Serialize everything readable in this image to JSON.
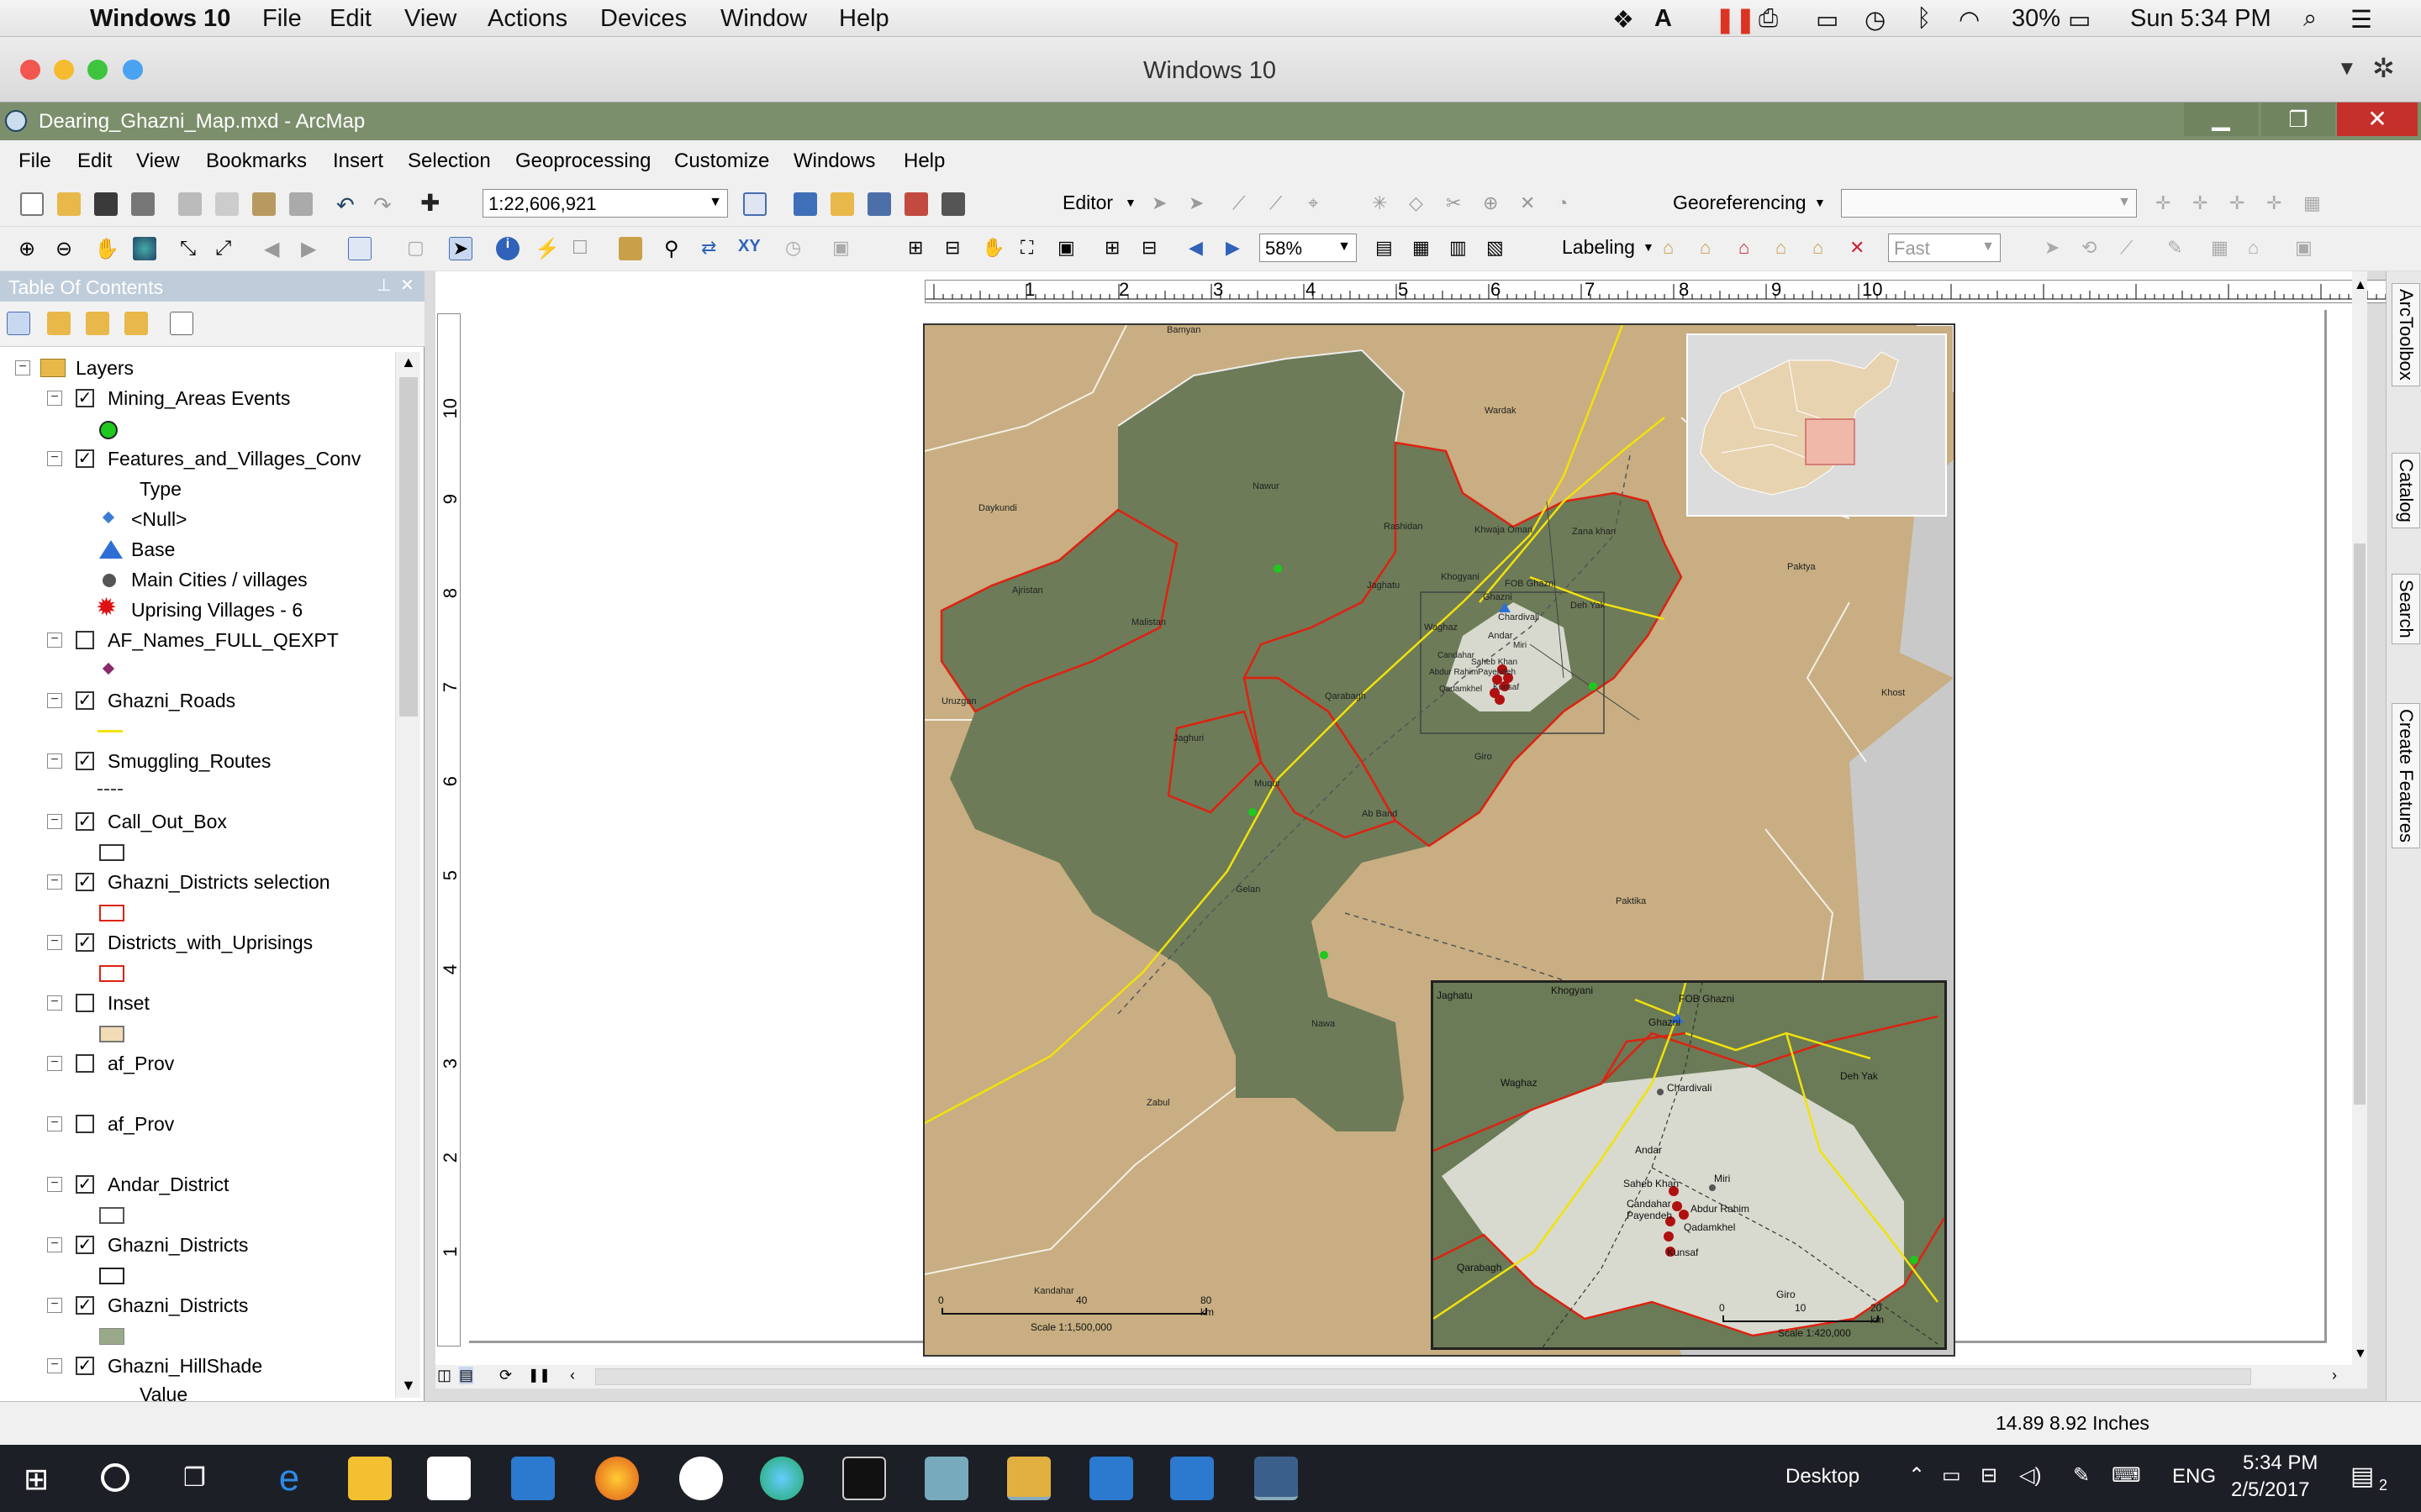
{
  "mac_menubar": {
    "app_name": "Windows 10",
    "menus": [
      "File",
      "Edit",
      "View",
      "Actions",
      "Devices",
      "Window",
      "Help"
    ],
    "battery": "30%",
    "clock": "Sun 5:34 PM"
  },
  "vm_window": {
    "title": "Windows 10"
  },
  "arc_window": {
    "title": "Dearing_Ghazni_Map.mxd - ArcMap"
  },
  "arc_menus": [
    "File",
    "Edit",
    "View",
    "Bookmarks",
    "Insert",
    "Selection",
    "Geoprocessing",
    "Customize",
    "Windows",
    "Help"
  ],
  "toolbar1": {
    "scale": "1:22,606,921",
    "editor_label": "Editor",
    "georef_label": "Georeferencing",
    "georef_value": ""
  },
  "toolbar2": {
    "zoom": "58%",
    "labeling_label": "Labeling",
    "quality": "Fast"
  },
  "toc": {
    "title": "Table Of Contents",
    "root": "Layers",
    "layers": [
      {
        "name": "Mining_Areas Events",
        "checked": true,
        "symbol": "green-circle"
      },
      {
        "name": "Features_and_Villages_Conv",
        "checked": true,
        "sub_header": "Type",
        "items": [
          {
            "label": "<Null>",
            "symbol": "blue-diamond"
          },
          {
            "label": "Base",
            "symbol": "blue-triangle"
          },
          {
            "label": "Main Cities / villages",
            "symbol": "gray-dot"
          },
          {
            "label": "Uprising Villages - 6",
            "symbol": "red-burst"
          }
        ]
      },
      {
        "name": "AF_Names_FULL_QEXPT",
        "checked": false,
        "symbol": "purple-diamond"
      },
      {
        "name": "Ghazni_Roads",
        "checked": true,
        "symbol": "yellow-line"
      },
      {
        "name": "Smuggling_Routes",
        "checked": true,
        "symbol": "dashed-line"
      },
      {
        "name": "Call_Out_Box",
        "checked": true,
        "symbol": "white-box"
      },
      {
        "name": "Ghazni_Districts selection",
        "checked": true,
        "symbol": "red-box"
      },
      {
        "name": "Districts_with_Uprisings",
        "checked": true,
        "symbol": "red-box"
      },
      {
        "name": "Inset",
        "checked": false,
        "symbol": "tan-box"
      },
      {
        "name": "af_Prov",
        "checked": false,
        "symbol": ""
      },
      {
        "name": "af_Prov",
        "checked": false,
        "symbol": ""
      },
      {
        "name": "Andar_District",
        "checked": true,
        "symbol": "white-box"
      },
      {
        "name": "Ghazni_Districts",
        "checked": true,
        "symbol": "white-box"
      },
      {
        "name": "Ghazni_Districts",
        "checked": true,
        "symbol": "green-box"
      },
      {
        "name": "Ghazni_HillShade",
        "checked": true,
        "sub_header": "Value"
      }
    ]
  },
  "ruler": {
    "h_ticks": [
      "1",
      "2",
      "3",
      "4",
      "5",
      "6",
      "7",
      "8",
      "9",
      "10"
    ],
    "v_ticks": [
      "10",
      "9",
      "8",
      "7",
      "6",
      "5",
      "4",
      "3",
      "2",
      "1"
    ]
  },
  "map_labels": {
    "main": [
      "Bamyan",
      "Daykundi",
      "Nawur",
      "Wardak",
      "Rashidan",
      "Khwaja Omari",
      "Zana khan",
      "Ajristan",
      "Malistan",
      "Jaghatu",
      "Khogyani",
      "FOB Ghazni",
      "Ghazni",
      "Chardivali",
      "Deh Yak",
      "Waghaz",
      "Andar",
      "Giro",
      "Qarabagh",
      "Jaghuri",
      "Muqur",
      "Ab Band",
      "Gelan",
      "Nawa",
      "Paktika",
      "Paktya",
      "Khost",
      "Uruzgan",
      "Zabul",
      "Kandahar",
      "Saheb Khan",
      "Abdur Rahim",
      "Payendeh",
      "Qadamkhel",
      "Kunsaf",
      "Candahar",
      "Miri"
    ],
    "main_scale_ticks": [
      "0",
      "40",
      "80 km"
    ],
    "main_scale_text": "Scale 1:1,500,000",
    "inset": [
      "Jaghatu",
      "Khogyani",
      "FOB Ghazni",
      "Ghazni",
      "Waghaz",
      "Chardivali",
      "Deh Yak",
      "Andar",
      "Miri",
      "Saheb Khan",
      "Candahar",
      "Payendeh",
      "Abdur Rahim",
      "Qadamkhel",
      "Kunsaf",
      "Qarabagh",
      "Giro"
    ],
    "inset_scale_ticks": [
      "0",
      "10",
      "20 km"
    ],
    "inset_scale_text": "Scale 1:420,000"
  },
  "statusbar": {
    "coords": "14.89  8.92 Inches"
  },
  "taskbar": {
    "desktop_label": "Desktop",
    "lang": "ENG",
    "time": "5:34 PM",
    "date": "2/5/2017",
    "notifications": "2"
  },
  "right_dock": [
    "ArcToolbox",
    "Catalog",
    "Search",
    "Create Features"
  ]
}
